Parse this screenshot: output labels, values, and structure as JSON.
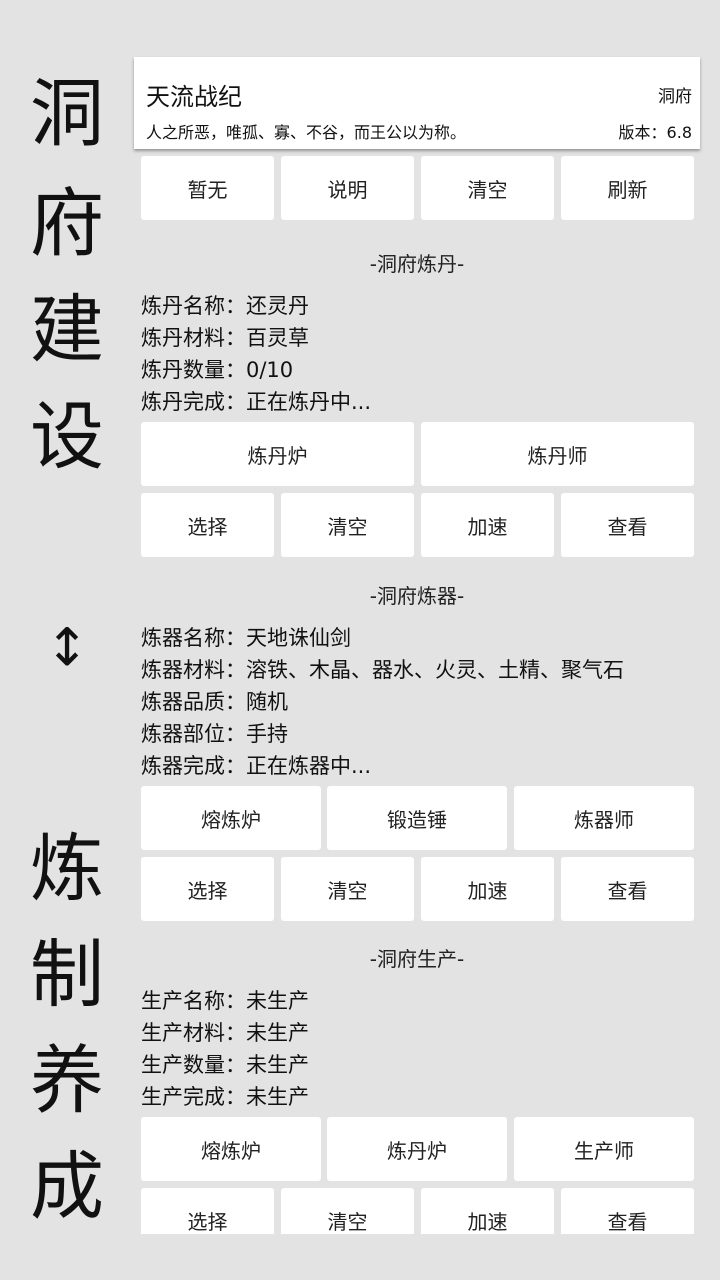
{
  "side": {
    "top_chars": [
      "洞",
      "府",
      "建",
      "设"
    ],
    "arrow": "↕",
    "bottom_chars": [
      "炼",
      "制",
      "养",
      "成"
    ]
  },
  "header": {
    "title": "天流战纪",
    "tag": "洞府",
    "motto": "人之所恶，唯孤、寡、不谷，而王公以为称。",
    "version": "版本：6.8"
  },
  "toolbar": [
    "暂无",
    "说明",
    "清空",
    "刷新"
  ],
  "alchemy": {
    "title": "-洞府炼丹-",
    "lines": [
      "炼丹名称：还灵丹",
      "炼丹材料：百灵草",
      "炼丹数量：0/10",
      "炼丹完成：正在炼丹中..."
    ],
    "buttons_row1": [
      "炼丹炉",
      "炼丹师"
    ],
    "buttons_row2": [
      "选择",
      "清空",
      "加速",
      "查看"
    ]
  },
  "forging": {
    "title": "-洞府炼器-",
    "lines": [
      "炼器名称：天地诛仙剑",
      "炼器材料：溶铁、木晶、器水、火灵、土精、聚气石",
      "炼器品质：随机",
      "炼器部位：手持",
      "炼器完成：正在炼器中..."
    ],
    "buttons_row1": [
      "熔炼炉",
      "锻造锤",
      "炼器师"
    ],
    "buttons_row2": [
      "选择",
      "清空",
      "加速",
      "查看"
    ]
  },
  "production": {
    "title": "-洞府生产-",
    "lines": [
      "生产名称：未生产",
      "生产材料：未生产",
      "生产数量：未生产",
      "生产完成：未生产"
    ],
    "buttons_row1": [
      "熔炼炉",
      "炼丹炉",
      "生产师"
    ],
    "buttons_row2": [
      "选择",
      "清空",
      "加速",
      "查看"
    ]
  }
}
